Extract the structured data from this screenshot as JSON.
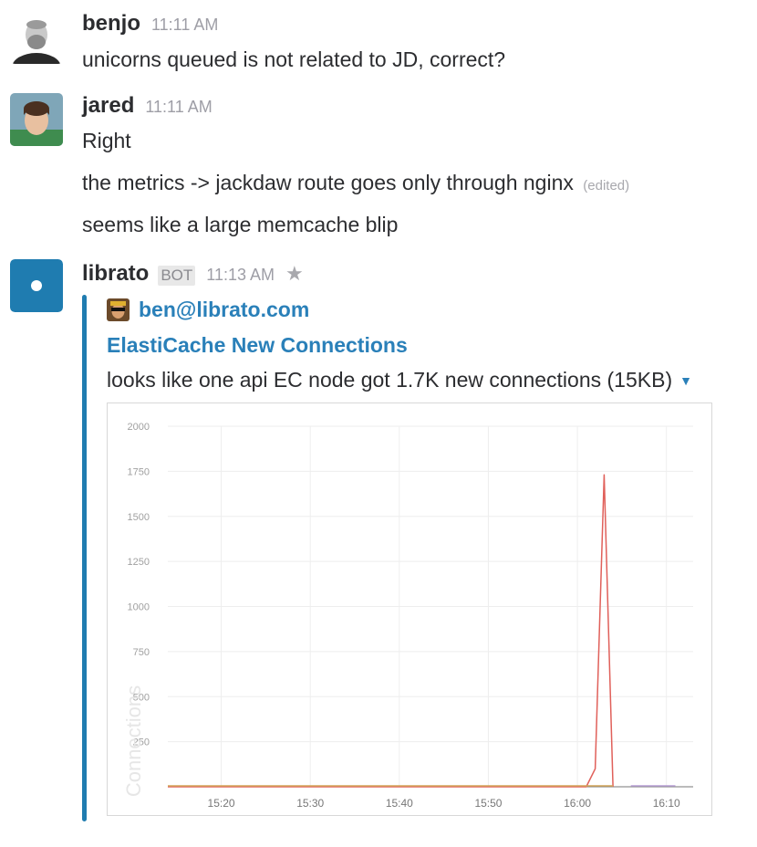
{
  "messages": [
    {
      "user": "benjo",
      "time": "11:11 AM",
      "lines": [
        "unicorns queued is not related to JD, correct?"
      ]
    },
    {
      "user": "jared",
      "time": "11:11 AM",
      "lines": [
        "Right",
        "the metrics -> jackdaw route goes only through nginx",
        "seems like a large memcache blip"
      ],
      "edited_label": "(edited)"
    },
    {
      "user": "librato",
      "badge": "BOT",
      "time": "11:13 AM",
      "attachment": {
        "author": "ben@librato.com",
        "title": "ElastiCache New Connections",
        "text": "looks like one api EC node got 1.7K new connections (15KB)"
      }
    }
  ],
  "icons": {
    "star": "star-icon",
    "caret": "caret-down-icon"
  },
  "colors": {
    "link": "#2a80b9",
    "attachment_bar": "#1f7cb0",
    "series_main": "#e0605a",
    "series_flat": "#d4a55a"
  },
  "chart_data": {
    "type": "line",
    "ylabel": "Connections",
    "ylim": [
      0,
      2000
    ],
    "y_ticks": [
      0,
      250,
      500,
      750,
      1000,
      1250,
      1500,
      1750,
      2000
    ],
    "y_tick_labels": [
      "",
      "250",
      "500",
      "750",
      "1000",
      "1250",
      "1500",
      "1750",
      "2000"
    ],
    "x_ticks": [
      "15:20",
      "15:30",
      "15:40",
      "15:50",
      "16:00",
      "16:10"
    ],
    "xlim": [
      "15:14",
      "16:13"
    ],
    "series": [
      {
        "color": "#e0605a",
        "points": [
          [
            "15:14",
            0
          ],
          [
            "16:01",
            0
          ],
          [
            "16:02",
            100
          ],
          [
            "16:03",
            1730
          ],
          [
            "16:04",
            0
          ]
        ]
      },
      {
        "color": "#d4a55a",
        "points": [
          [
            "15:14",
            5
          ],
          [
            "16:04",
            5
          ]
        ]
      },
      {
        "color": "#b9a0d6",
        "points": [
          [
            "16:06",
            5
          ],
          [
            "16:11",
            5
          ]
        ]
      }
    ],
    "grid": true
  }
}
